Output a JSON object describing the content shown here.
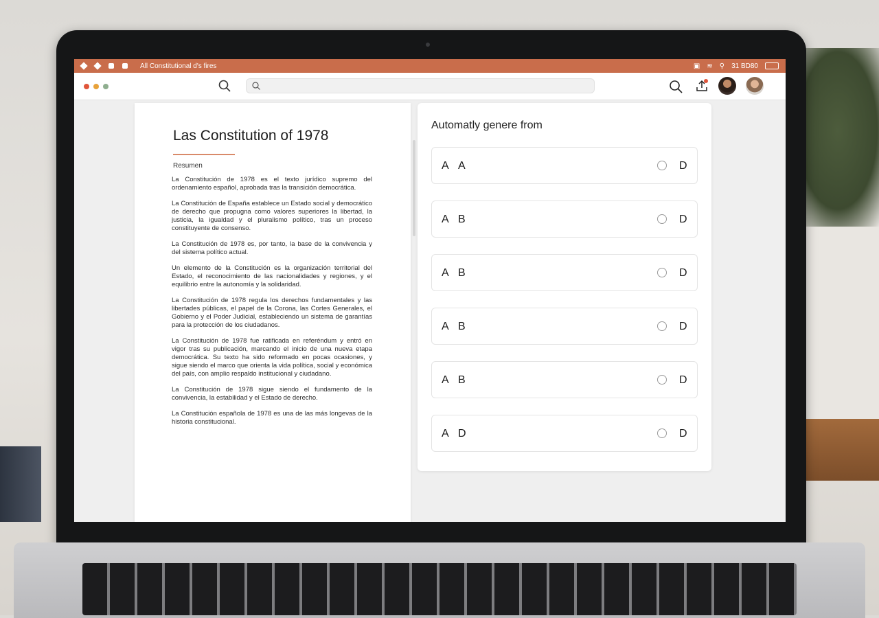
{
  "menubar": {
    "app_title": "All Constitutional d's fires",
    "status_text": "31 BD80"
  },
  "search": {
    "value": "",
    "placeholder": ""
  },
  "document": {
    "title": "Las Constitution of 1978",
    "subtitle": "Resumen",
    "paragraphs": [
      "La Constitución de 1978 es el texto jurídico supremo del ordenamiento español, aprobada tras la transición democrática.",
      "La Constitución de España establece un Estado social y democrático de derecho que propugna como valores superiores la libertad, la justicia, la igualdad y el pluralismo político, tras un proceso constituyente de consenso.",
      "La Constitución de 1978 es, por tanto, la base de la convivencia y del sistema político actual.",
      "Un elemento de la Constitución es la organización territorial del Estado, el reconocimiento de las nacionalidades y regiones, y el equilibrio entre la autonomía y la solidaridad.",
      "La Constitución de 1978 regula los derechos fundamentales y las libertades públicas, el papel de la Corona, las Cortes Generales, el Gobierno y el Poder Judicial, estableciendo un sistema de garantías para la protección de los ciudadanos.",
      "La Constitución de 1978 fue ratificada en referéndum y entró en vigor tras su publicación, marcando el inicio de una nueva etapa democrática. Su texto ha sido reformado en pocas ocasiones, y sigue siendo el marco que orienta la vida política, social y económica del país, con amplio respaldo institucional y ciudadano.",
      "La Constitución de 1978 sigue siendo el fundamento de la convivencia, la estabilidad y el Estado de derecho.",
      "La Constitución española de 1978 es una de las más longevas de la historia constitucional."
    ]
  },
  "panel": {
    "title": "Automatly genere from",
    "options": [
      {
        "left": "A",
        "mid": "A",
        "right": "D"
      },
      {
        "left": "A",
        "mid": "B",
        "right": "D"
      },
      {
        "left": "A",
        "mid": "B",
        "right": "D"
      },
      {
        "left": "A",
        "mid": "B",
        "right": "D"
      },
      {
        "left": "A",
        "mid": "B",
        "right": "D"
      },
      {
        "left": "A",
        "mid": "D",
        "right": "D"
      }
    ]
  },
  "colors": {
    "menubar": "#c96d4b",
    "accent_rule": "#d98a6a",
    "notification": "#e0553a",
    "window_close": "#e0553a",
    "window_minimize": "#e8a23a",
    "window_zoom": "#8fae8f"
  },
  "icons": [
    "diamond-icon",
    "home-icon",
    "refresh-icon",
    "search-icon",
    "share-icon",
    "wifi-icon",
    "battery-icon",
    "avatar"
  ]
}
